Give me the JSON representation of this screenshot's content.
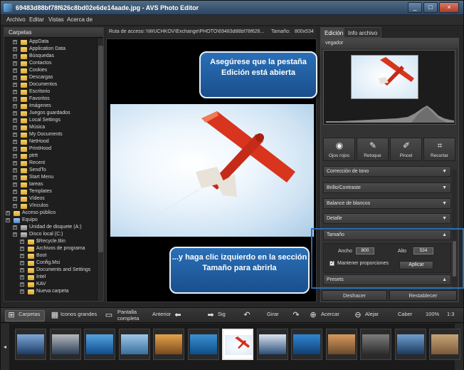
{
  "window": {
    "file_title": "69483d88bf78f626c8bd02e6de14aade.jpg",
    "separator": "-",
    "app_name": "AVS Photo Editor",
    "controls": [
      "_",
      "□",
      "×"
    ]
  },
  "menu": [
    "Archivo",
    "Editar",
    "Vistas",
    "Acerca de"
  ],
  "folders_panel": {
    "header": "Carpetas",
    "items": [
      {
        "label": "AppData",
        "indent": 1,
        "type": "folder"
      },
      {
        "label": "Application Data",
        "indent": 1,
        "type": "folder"
      },
      {
        "label": "Búsquedas",
        "indent": 1,
        "type": "folder"
      },
      {
        "label": "Contactos",
        "indent": 1,
        "type": "folder"
      },
      {
        "label": "Cookies",
        "indent": 1,
        "type": "folder"
      },
      {
        "label": "Descargas",
        "indent": 1,
        "type": "folder"
      },
      {
        "label": "Documentos",
        "indent": 1,
        "type": "folder"
      },
      {
        "label": "Escritorio",
        "indent": 1,
        "type": "folder"
      },
      {
        "label": "Favoritos",
        "indent": 1,
        "type": "folder"
      },
      {
        "label": "Imágenes",
        "indent": 1,
        "type": "folder"
      },
      {
        "label": "Juegos guardados",
        "indent": 1,
        "type": "folder"
      },
      {
        "label": "Local Settings",
        "indent": 1,
        "type": "folder"
      },
      {
        "label": "Música",
        "indent": 1,
        "type": "folder"
      },
      {
        "label": "My Documents",
        "indent": 1,
        "type": "folder"
      },
      {
        "label": "NetHood",
        "indent": 1,
        "type": "folder"
      },
      {
        "label": "PrintHood",
        "indent": 1,
        "type": "folder"
      },
      {
        "label": "ptrtt",
        "indent": 1,
        "type": "folder"
      },
      {
        "label": "Recent",
        "indent": 1,
        "type": "folder"
      },
      {
        "label": "SendTo",
        "indent": 1,
        "type": "folder"
      },
      {
        "label": "Start Menu",
        "indent": 1,
        "type": "folder"
      },
      {
        "label": "tareas",
        "indent": 1,
        "type": "folder"
      },
      {
        "label": "Templates",
        "indent": 1,
        "type": "folder"
      },
      {
        "label": "Vídeos",
        "indent": 1,
        "type": "folder"
      },
      {
        "label": "Vínculos",
        "indent": 1,
        "type": "folder"
      },
      {
        "label": "Acceso público",
        "indent": 0,
        "type": "folder"
      },
      {
        "label": "Equipo",
        "indent": 0,
        "type": "blue"
      },
      {
        "label": "Unidad de disquete (A:)",
        "indent": 1,
        "type": "drive"
      },
      {
        "label": "Disco local (C:)",
        "indent": 1,
        "type": "drive"
      },
      {
        "label": "$Recycle.Bin",
        "indent": 2,
        "type": "folder"
      },
      {
        "label": "Archivos de programa",
        "indent": 2,
        "type": "folder"
      },
      {
        "label": "Boot",
        "indent": 2,
        "type": "folder"
      },
      {
        "label": "Config.Msi",
        "indent": 2,
        "type": "folder"
      },
      {
        "label": "Documents and Settings",
        "indent": 2,
        "type": "folder"
      },
      {
        "label": "Intel",
        "indent": 2,
        "type": "folder"
      },
      {
        "label": "KAV",
        "indent": 2,
        "type": "folder"
      },
      {
        "label": "Nueva carpeta",
        "indent": 2,
        "type": "folder"
      }
    ]
  },
  "path_bar": {
    "path_label": "Ruta de acceso:",
    "path_value": "\\\\WUCHKOV\\Exchange\\PHOTO\\69483d88bf78f626...",
    "size_label": "Tamaño:",
    "size_value": "800x534"
  },
  "callouts": {
    "top": "Asegúrese que la pestaña Edición está abierta",
    "bottom": "...y haga clic izquierdo en la sección Tamaño para abrirla"
  },
  "right_panel": {
    "tabs": [
      "Edición",
      "Info archivo"
    ],
    "navigator_label": "vegador",
    "tools": [
      {
        "label": "Ojos rojos",
        "icon": "eye-icon"
      },
      {
        "label": "Retoque",
        "icon": "brush-icon"
      },
      {
        "label": "Pincel",
        "icon": "pencil-icon"
      },
      {
        "label": "Recortar",
        "icon": "crop-icon"
      }
    ],
    "sections": [
      "Corrección de tono",
      "Brillo/Contraste",
      "Balance de blancos",
      "Detalle",
      "Tamaño",
      "Presets"
    ],
    "size": {
      "width_label": "Ancho",
      "width_value": "800",
      "height_label": "Alto",
      "height_value": "534",
      "keep_proportions_label": "Mantener proporciones",
      "keep_proportions_checked": true,
      "apply_label": "Aplicar"
    },
    "undo_label": "Deshacer",
    "reset_label": "Restablecer"
  },
  "toolbar": {
    "folders": "Carpetas",
    "large_icons": "Iconos grandes",
    "fullscreen": "Pantalla completa",
    "previous": "Anterior",
    "next": "Sig",
    "rotate": "Girar",
    "zoom_in": "Acercar",
    "zoom_out": "Alejar",
    "fit": "Caber",
    "zoom_percent": "100%",
    "ratio": "1:3"
  },
  "filmstrip": {
    "prev": "◂",
    "next": "▸",
    "count": 13,
    "selected_index": 6
  },
  "colors": {
    "accent": "#2a6fb7",
    "plane_red": "#d9341d"
  }
}
